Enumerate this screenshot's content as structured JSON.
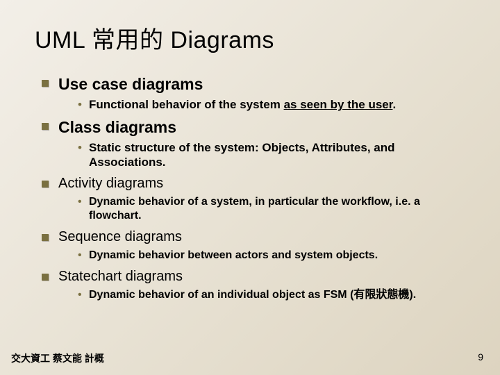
{
  "title": "UML 常用的 Diagrams",
  "items": [
    {
      "head": "Use case diagrams",
      "big": true,
      "sub_pre": "Functional behavior of the system ",
      "sub_ul": "as seen by the user",
      "sub_post": "."
    },
    {
      "head": "Class diagrams",
      "big": true,
      "sub": "Static structure of the system: Objects, Attributes, and Associations."
    },
    {
      "head": "Activity diagrams",
      "big": false,
      "sub": "Dynamic behavior of a system, in particular the  workflow, i.e. a flowchart."
    },
    {
      "head": "Sequence diagrams",
      "big": false,
      "sub": "Dynamic behavior between actors and system objects."
    },
    {
      "head": "Statechart diagrams",
      "big": false,
      "sub": "Dynamic behavior of an individual object as FSM (有限狀態機)."
    }
  ],
  "footer": "交大資工 蔡文能 計概",
  "page_number": "9"
}
